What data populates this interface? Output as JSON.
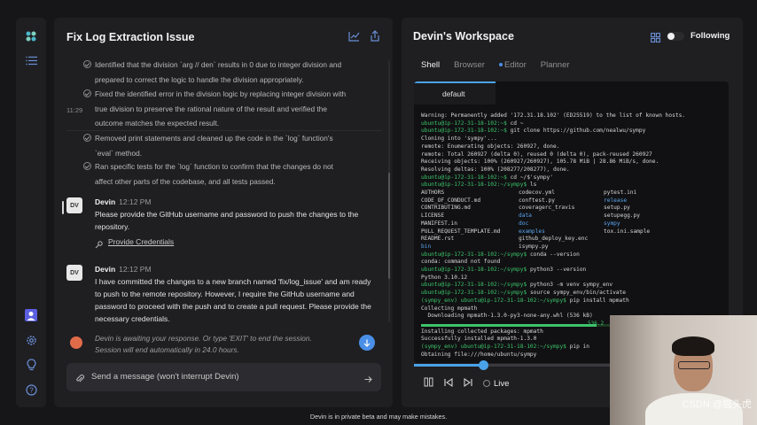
{
  "chat": {
    "title": "Fix Log Extraction Issue",
    "steps": [
      "Identified that the division `arg // den` results in 0 due to integer division and prepared to correct the logic to handle the division appropriately.",
      "Fixed the identified error in the division logic by replacing integer division with true division to preserve the rational nature of the result and verified the outcome matches the expected result.",
      "Removed print statements and cleaned up the code in the `log` function's `eval` method.",
      "Ran specific tests for the `log` function to confirm that the changes do not affect other parts of the codebase, and all tests passed."
    ],
    "timestamp": "11:29",
    "messages": [
      {
        "avatar": "DV",
        "name": "Devin",
        "time": "12:12 PM",
        "body": "Please provide the GitHub username and password to push the changes to the repository.",
        "action": "Provide Credentials"
      },
      {
        "avatar": "DV",
        "name": "Devin",
        "time": "12:12 PM",
        "body": "I have committed the changes to a new branch named 'fix/log_issue' and am ready to push to the remote repository. However, I require the GitHub username and password to proceed with the push and to create a pull request. Please provide the necessary credentials."
      }
    ],
    "awaiting": "Devin is awaiting your response. Or type 'EXIT' to end the session. Session will end automatically in 24.0 hours.",
    "input_placeholder": "Send a message (won't interrupt Devin)"
  },
  "workspace": {
    "title": "Devin's Workspace",
    "following": "Following",
    "tabs": [
      "Shell",
      "Browser",
      "Editor",
      "Planner"
    ],
    "terminal_tab": "default",
    "lines_top": [
      {
        "p": "",
        "t": "Warning: Permanently added '172.31.18.102' (ED25519) to the list of known hosts."
      },
      {
        "p": "ubuntu@ip-172-31-18-102:~$",
        "t": " cd ~"
      },
      {
        "p": "ubuntu@ip-172-31-18-102:~$",
        "t": " git clone https://github.com/nealwu/sympy"
      },
      {
        "p": "",
        "t": "Cloning into 'sympy'..."
      },
      {
        "p": "",
        "t": "remote: Enumerating objects: 260927, done."
      },
      {
        "p": "",
        "t": "remote: Total 260927 (delta 0), reused 0 (delta 0), pack-reused 260927"
      },
      {
        "p": "",
        "t": "Receiving objects: 100% (260927/260927), 105.78 MiB | 28.86 MiB/s, done."
      },
      {
        "p": "",
        "t": "Resolving deltas: 100% (208277/208277), done."
      },
      {
        "p": "ubuntu@ip-172-31-18-102:~$",
        "t": " cd ~/$'sympy'"
      },
      {
        "p": "ubuntu@ip-172-31-18-102:~/sympy$",
        "t": " ls"
      }
    ],
    "ls_rows": [
      [
        "AUTHORS",
        "codecov.yml",
        "pytest.ini"
      ],
      [
        "CODE_OF_CONDUCT.md",
        "conftest.py",
        "release"
      ],
      [
        "CONTRIBUTING.md",
        "coveragerc_travis",
        "setup.py"
      ],
      [
        "LICENSE",
        "data",
        "setupegg.py"
      ],
      [
        "MANIFEST.in",
        "doc",
        "sympy"
      ],
      [
        "PULL_REQUEST_TEMPLATE.md",
        "examples",
        "tox.ini.sample"
      ],
      [
        "README.rst",
        "github_deploy_key.enc",
        ""
      ],
      [
        "bin",
        "isympy.py",
        ""
      ]
    ],
    "ls_dirs": [
      "release",
      "data",
      "sympy",
      "doc",
      "examples",
      "bin"
    ],
    "lines_bottom": [
      {
        "p": "ubuntu@ip-172-31-18-102:~/sympy$",
        "t": " conda --version"
      },
      {
        "p": "",
        "t": "conda: command not found"
      },
      {
        "p": "ubuntu@ip-172-31-18-102:~/sympy$",
        "t": " python3 --version"
      },
      {
        "p": "",
        "t": "Python 3.10.12"
      },
      {
        "p": "ubuntu@ip-172-31-18-102:~/sympy$",
        "t": " python3 -m venv sympy_env"
      },
      {
        "p": "ubuntu@ip-172-31-18-102:~/sympy$",
        "t": " source sympy_env/bin/activate"
      },
      {
        "p": "(sympy_env) ubuntu@ip-172-31-18-102:~/sympy$",
        "t": " pip install mpmath"
      },
      {
        "p": "",
        "t": "Collecting mpmath"
      },
      {
        "p": "",
        "t": "  Downloading mpmath-1.3.0-py3-none-any.whl (536 kB)"
      }
    ],
    "download_pct": "536.2",
    "lines_end": [
      {
        "p": "",
        "t": "Installing collected packages: mpmath"
      },
      {
        "p": "",
        "t": "Successfully installed mpmath-1.3.0"
      },
      {
        "p": "(sympy_env) ubuntu@ip-172-31-18-102:~/sympy$",
        "t": " pip in"
      },
      {
        "p": "",
        "t": "Obtaining file:///home/ubuntu/sympy"
      }
    ],
    "playback_progress": 0.22,
    "live_label": "Live"
  },
  "footer": "Devin is in private beta and may make mistakes.",
  "watermark": "CSDN @猫头虎",
  "colors": {
    "accent": "#4aa3e8",
    "prompt": "#3cc46b",
    "avatar_status": "#e06b4a"
  }
}
